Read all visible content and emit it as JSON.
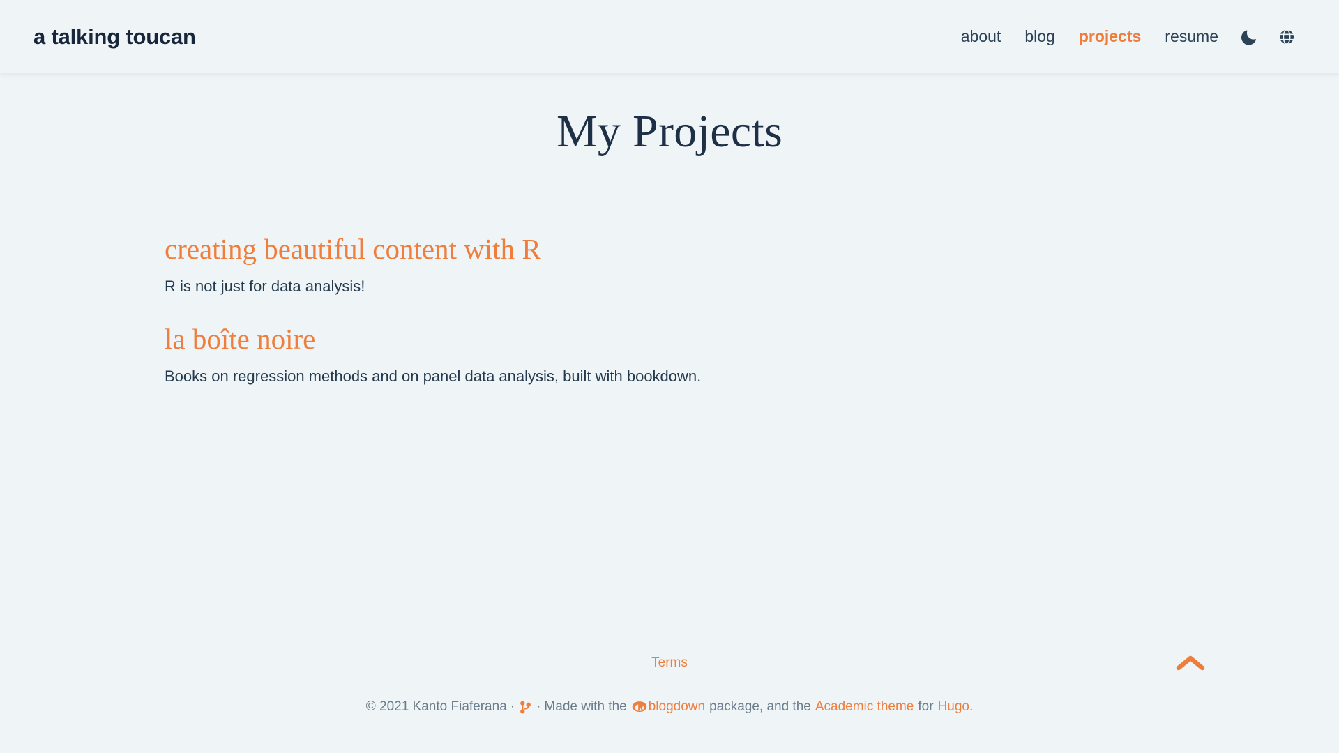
{
  "site": {
    "brand": "a talking toucan",
    "accent_color": "#ef7e3c",
    "text_color": "#1f3040",
    "background_color": "#eff4f7"
  },
  "nav": {
    "items": [
      {
        "label": "about",
        "active": false
      },
      {
        "label": "blog",
        "active": false
      },
      {
        "label": "projects",
        "active": true
      },
      {
        "label": "resume",
        "active": false
      }
    ],
    "dark_mode_icon": "moon-icon",
    "language_icon": "globe-icon"
  },
  "main": {
    "page_title": "My Projects",
    "projects": [
      {
        "title": "creating beautiful content with R",
        "description": "R is not just for data analysis!"
      },
      {
        "title": "la boîte noire",
        "description": "Books on regression methods and on panel data analysis, built with bookdown."
      }
    ]
  },
  "footer": {
    "terms_label": "Terms",
    "copyright": "© 2021 Kanto Fiaferana",
    "separator_dot": "·",
    "git_icon": "git-branch-icon",
    "made_with_prefix": "Made with the",
    "blogdown_icon": "r-logo-icon",
    "blogdown_link": "blogdown",
    "package_text": "package, and the",
    "academic_link": "Academic theme",
    "for_text": "for",
    "hugo_link": "Hugo",
    "period": ".",
    "back_to_top_icon": "chevron-up-icon"
  }
}
